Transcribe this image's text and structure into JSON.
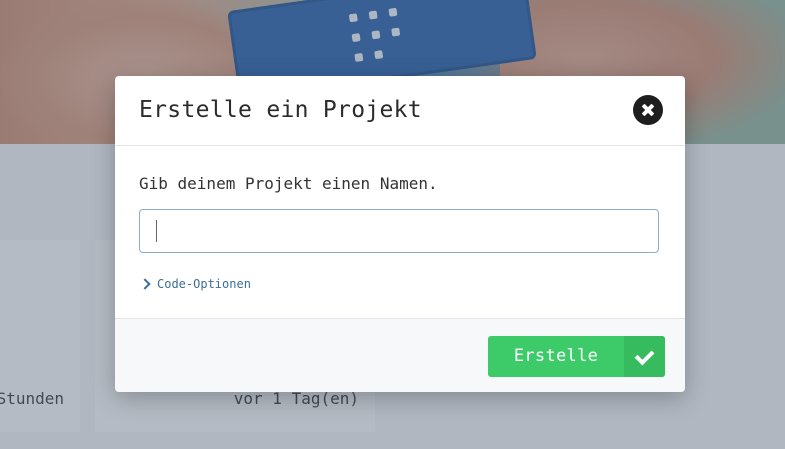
{
  "background": {
    "cards": [
      {
        "meta": "Stunden"
      },
      {
        "meta": "vor 1 Tag(en)"
      }
    ]
  },
  "modal": {
    "title": "Erstelle ein Projekt",
    "prompt": "Gib deinem Projekt einen Namen.",
    "name_input": {
      "value": "",
      "placeholder": ""
    },
    "code_options_label": "Code-Optionen",
    "create_button_label": "Erstelle",
    "icons": {
      "close": "close-circle-icon",
      "code_toggle": "chevron-right-icon",
      "create": "check-icon"
    }
  },
  "colors": {
    "accent_green": "#3dcb6a",
    "link_blue": "#3a6e99",
    "input_border": "#8ab0c9"
  }
}
